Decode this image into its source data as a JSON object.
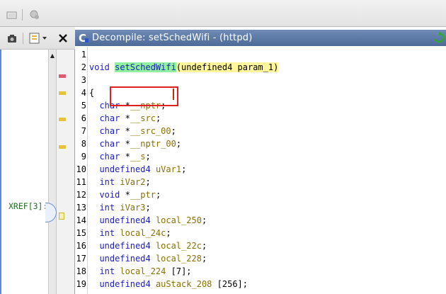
{
  "decompile": {
    "title": "Decompile: setSchedWifi -  (httpd)",
    "lines": [
      {
        "n": "1",
        "parts": []
      },
      {
        "n": "2",
        "parts": [
          {
            "t": "void ",
            "c": "ty"
          },
          {
            "t": "setSchedWifi",
            "c": "fn-hl"
          },
          {
            "t": "(undefined4 param_1)",
            "c": "param-hl"
          }
        ]
      },
      {
        "n": "3",
        "parts": []
      },
      {
        "n": "4",
        "parts": [
          {
            "t": "{",
            "c": ""
          }
        ]
      },
      {
        "n": "5",
        "parts": [
          {
            "t": "  char",
            "c": "ty"
          },
          {
            "t": " *",
            "c": ""
          },
          {
            "t": "__nptr",
            "c": "var"
          },
          {
            "t": ";",
            "c": ""
          }
        ]
      },
      {
        "n": "6",
        "parts": [
          {
            "t": "  char",
            "c": "ty"
          },
          {
            "t": " *",
            "c": ""
          },
          {
            "t": "__src",
            "c": "var"
          },
          {
            "t": ";",
            "c": ""
          }
        ]
      },
      {
        "n": "7",
        "parts": [
          {
            "t": "  char",
            "c": "ty"
          },
          {
            "t": " *",
            "c": ""
          },
          {
            "t": "__src_00",
            "c": "var"
          },
          {
            "t": ";",
            "c": ""
          }
        ]
      },
      {
        "n": "8",
        "parts": [
          {
            "t": "  char",
            "c": "ty"
          },
          {
            "t": " *",
            "c": ""
          },
          {
            "t": "__nptr_00",
            "c": "var"
          },
          {
            "t": ";",
            "c": ""
          }
        ]
      },
      {
        "n": "9",
        "parts": [
          {
            "t": "  char",
            "c": "ty"
          },
          {
            "t": " *",
            "c": ""
          },
          {
            "t": "__s",
            "c": "var"
          },
          {
            "t": ";",
            "c": ""
          }
        ]
      },
      {
        "n": "10",
        "parts": [
          {
            "t": "  undefined4",
            "c": "ty"
          },
          {
            "t": " ",
            "c": ""
          },
          {
            "t": "uVar1",
            "c": "var"
          },
          {
            "t": ";",
            "c": ""
          }
        ]
      },
      {
        "n": "11",
        "parts": [
          {
            "t": "  int",
            "c": "ty"
          },
          {
            "t": " ",
            "c": ""
          },
          {
            "t": "iVar2",
            "c": "var"
          },
          {
            "t": ";",
            "c": ""
          }
        ]
      },
      {
        "n": "12",
        "parts": [
          {
            "t": "  void",
            "c": "ty"
          },
          {
            "t": " *",
            "c": ""
          },
          {
            "t": "__ptr",
            "c": "var"
          },
          {
            "t": ";",
            "c": ""
          }
        ]
      },
      {
        "n": "13",
        "parts": [
          {
            "t": "  int",
            "c": "ty"
          },
          {
            "t": " ",
            "c": ""
          },
          {
            "t": "iVar3",
            "c": "var"
          },
          {
            "t": ";",
            "c": ""
          }
        ]
      },
      {
        "n": "14",
        "parts": [
          {
            "t": "  undefined4",
            "c": "ty"
          },
          {
            "t": " ",
            "c": ""
          },
          {
            "t": "local_250",
            "c": "var"
          },
          {
            "t": ";",
            "c": ""
          }
        ]
      },
      {
        "n": "15",
        "parts": [
          {
            "t": "  int",
            "c": "ty"
          },
          {
            "t": " ",
            "c": ""
          },
          {
            "t": "local_24c",
            "c": "var"
          },
          {
            "t": ";",
            "c": ""
          }
        ]
      },
      {
        "n": "16",
        "parts": [
          {
            "t": "  undefined4",
            "c": "ty"
          },
          {
            "t": " ",
            "c": ""
          },
          {
            "t": "local_22c",
            "c": "var"
          },
          {
            "t": ";",
            "c": ""
          }
        ]
      },
      {
        "n": "17",
        "parts": [
          {
            "t": "  undefined4",
            "c": "ty"
          },
          {
            "t": " ",
            "c": ""
          },
          {
            "t": "local_228",
            "c": "var"
          },
          {
            "t": ";",
            "c": ""
          }
        ]
      },
      {
        "n": "18",
        "parts": [
          {
            "t": "  int",
            "c": "ty"
          },
          {
            "t": " ",
            "c": ""
          },
          {
            "t": "local_224",
            "c": "var"
          },
          {
            "t": " [7];",
            "c": ""
          }
        ]
      },
      {
        "n": "19",
        "parts": [
          {
            "t": "  undefined4",
            "c": "ty"
          },
          {
            "t": " ",
            "c": ""
          },
          {
            "t": "auStack_208",
            "c": "var"
          },
          {
            "t": " [256];",
            "c": ""
          }
        ]
      }
    ]
  },
  "listing": {
    "xref_label": "XREF[3]:"
  },
  "icons": {
    "toolbar": [
      "undo-icon",
      "properties-icon"
    ],
    "left_toolbar": [
      "snapshot-icon",
      "display-options-icon",
      "close-icon"
    ],
    "decompile": [
      "decompile-c-icon",
      "refresh-icon"
    ]
  },
  "colors": {
    "title_bar": "#5b78a6",
    "function_highlight": "#90f0a0",
    "param_highlight": "#fff59a",
    "selection_box": "#e02020",
    "keyword": "#1d1dbd",
    "variable": "#8a7000",
    "xref": "#1f6f1f"
  }
}
